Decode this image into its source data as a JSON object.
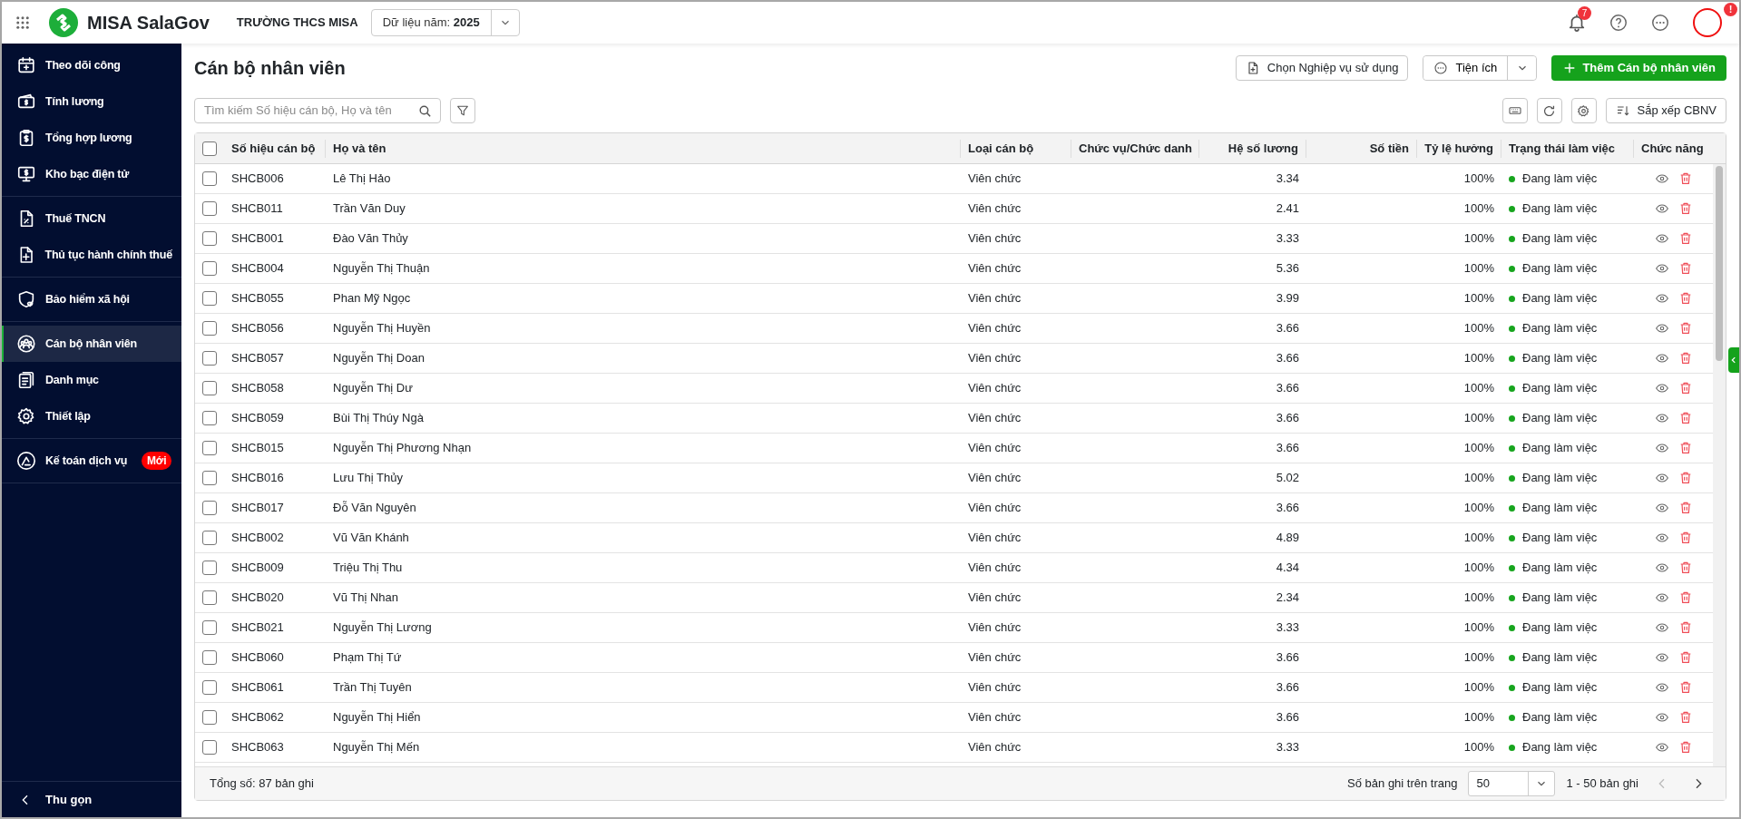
{
  "header": {
    "app_name": "MISA SalaGov",
    "school": "TRƯỜNG THCS MISA",
    "year_label": "Dữ liệu năm:",
    "year": "2025",
    "notification_count": "7",
    "avatar_badge": "!"
  },
  "sidebar": {
    "groups": [
      [
        {
          "label": "Theo dõi công",
          "selected": false
        },
        {
          "label": "Tính lương",
          "selected": false
        },
        {
          "label": "Tổng hợp lương",
          "selected": false
        },
        {
          "label": "Kho bạc điện tử",
          "selected": false
        }
      ],
      [
        {
          "label": "Thuế TNCN",
          "selected": false
        },
        {
          "label": "Thủ tục hành chính thuế",
          "selected": false
        }
      ],
      [
        {
          "label": "Bảo hiểm xã hội",
          "selected": false
        }
      ],
      [
        {
          "label": "Cán bộ nhân viên",
          "selected": true
        },
        {
          "label": "Danh mục",
          "selected": false
        },
        {
          "label": "Thiết lập",
          "selected": false
        }
      ],
      [
        {
          "label": "Kế toán dịch vụ",
          "selected": false,
          "badge": "Mới"
        }
      ]
    ],
    "collapse_label": "Thu gọn"
  },
  "page": {
    "title": "Cán bộ nhân viên",
    "buttons": {
      "choose": "Chọn Nghiệp vụ sử dụng",
      "utilities": "Tiện ích",
      "add": "Thêm Cán bộ nhân viên",
      "sort": "Sắp xếp CBNV"
    },
    "search": {
      "placeholder": "Tìm kiếm Số hiệu cán bộ, Họ và tên"
    }
  },
  "table": {
    "header_checked": false,
    "columns": [
      "Số hiệu cán bộ",
      "Họ và tên",
      "Loại cán bộ",
      "Chức vụ/Chức danh",
      "Hệ số lương",
      "Số tiền",
      "Tỷ lệ hưởng",
      "Trạng thái làm việc",
      "Chức năng"
    ],
    "rows": [
      {
        "checked": false,
        "code": "SHCB006",
        "name": "Lê Thị Hảo",
        "type": "Viên chức",
        "coefficient": "3.34",
        "rate": "100%",
        "status": "Đang làm việc",
        "color": "#17a51e"
      },
      {
        "checked": false,
        "code": "SHCB011",
        "name": "Trần Văn Duy",
        "type": "Viên chức",
        "coefficient": "2.41",
        "rate": "100%",
        "status": "Đang làm việc",
        "color": "#17a51e"
      },
      {
        "checked": false,
        "code": "SHCB001",
        "name": "Đào Văn Thủy",
        "type": "Viên chức",
        "coefficient": "3.33",
        "rate": "100%",
        "status": "Đang làm việc",
        "color": "#17a51e"
      },
      {
        "checked": false,
        "code": "SHCB004",
        "name": "Nguyễn Thị Thuận",
        "type": "Viên chức",
        "coefficient": "5.36",
        "rate": "100%",
        "status": "Đang làm việc",
        "color": "#17a51e"
      },
      {
        "checked": false,
        "code": "SHCB055",
        "name": "Phan Mỹ Ngọc",
        "type": "Viên chức",
        "coefficient": "3.99",
        "rate": "100%",
        "status": "Đang làm việc",
        "color": "#17a51e"
      },
      {
        "checked": false,
        "code": "SHCB056",
        "name": "Nguyễn Thị Huyền",
        "type": "Viên chức",
        "coefficient": "3.66",
        "rate": "100%",
        "status": "Đang làm việc",
        "color": "#17a51e"
      },
      {
        "checked": false,
        "code": "SHCB057",
        "name": "Nguyễn Thị Doan",
        "type": "Viên chức",
        "coefficient": "3.66",
        "rate": "100%",
        "status": "Đang làm việc",
        "color": "#17a51e"
      },
      {
        "checked": false,
        "code": "SHCB058",
        "name": "Nguyễn Thị Dư",
        "type": "Viên chức",
        "coefficient": "3.66",
        "rate": "100%",
        "status": "Đang làm việc",
        "color": "#17a51e"
      },
      {
        "checked": false,
        "code": "SHCB059",
        "name": "Bùi Thị Thúy Ngà",
        "type": "Viên chức",
        "coefficient": "3.66",
        "rate": "100%",
        "status": "Đang làm việc",
        "color": "#17a51e"
      },
      {
        "checked": false,
        "code": "SHCB015",
        "name": "Nguyễn Thị Phương Nhạn",
        "type": "Viên chức",
        "coefficient": "3.66",
        "rate": "100%",
        "status": "Đang làm việc",
        "color": "#17a51e"
      },
      {
        "checked": false,
        "code": "SHCB016",
        "name": "Lưu Thị Thủy",
        "type": "Viên chức",
        "coefficient": "5.02",
        "rate": "100%",
        "status": "Đang làm việc",
        "color": "#17a51e"
      },
      {
        "checked": false,
        "code": "SHCB017",
        "name": "Đỗ Văn Nguyên",
        "type": "Viên chức",
        "coefficient": "3.66",
        "rate": "100%",
        "status": "Đang làm việc",
        "color": "#17a51e"
      },
      {
        "checked": false,
        "code": "SHCB002",
        "name": "Vũ Văn Khánh",
        "type": "Viên chức",
        "coefficient": "4.89",
        "rate": "100%",
        "status": "Đang làm việc",
        "color": "#17a51e"
      },
      {
        "checked": false,
        "code": "SHCB009",
        "name": "Triệu Thị Thu",
        "type": "Viên chức",
        "coefficient": "4.34",
        "rate": "100%",
        "status": "Đang làm việc",
        "color": "#17a51e"
      },
      {
        "checked": false,
        "code": "SHCB020",
        "name": "Vũ Thị Nhan",
        "type": "Viên chức",
        "coefficient": "2.34",
        "rate": "100%",
        "status": "Đang làm việc",
        "color": "#17a51e"
      },
      {
        "checked": false,
        "code": "SHCB021",
        "name": "Nguyễn Thị Lương",
        "type": "Viên chức",
        "coefficient": "3.33",
        "rate": "100%",
        "status": "Đang làm việc",
        "color": "#17a51e"
      },
      {
        "checked": false,
        "code": "SHCB060",
        "name": "Phạm Thị Tứ",
        "type": "Viên chức",
        "coefficient": "3.66",
        "rate": "100%",
        "status": "Đang làm việc",
        "color": "#17a51e"
      },
      {
        "checked": false,
        "code": "SHCB061",
        "name": "Trần Thị Tuyên",
        "type": "Viên chức",
        "coefficient": "3.66",
        "rate": "100%",
        "status": "Đang làm việc",
        "color": "#17a51e"
      },
      {
        "checked": false,
        "code": "SHCB062",
        "name": "Nguyễn Thị Hiển",
        "type": "Viên chức",
        "coefficient": "3.66",
        "rate": "100%",
        "status": "Đang làm việc",
        "color": "#17a51e"
      },
      {
        "checked": false,
        "code": "SHCB063",
        "name": "Nguyễn Thị Mến",
        "type": "Viên chức",
        "coefficient": "3.33",
        "rate": "100%",
        "status": "Đang làm việc",
        "color": "#17a51e"
      }
    ]
  },
  "footer": {
    "total": "Tổng số: 87 bản ghi",
    "page_size_label": "Số bản ghi trên trang",
    "page_size": "50",
    "range": "1 - 50 bản ghi"
  }
}
